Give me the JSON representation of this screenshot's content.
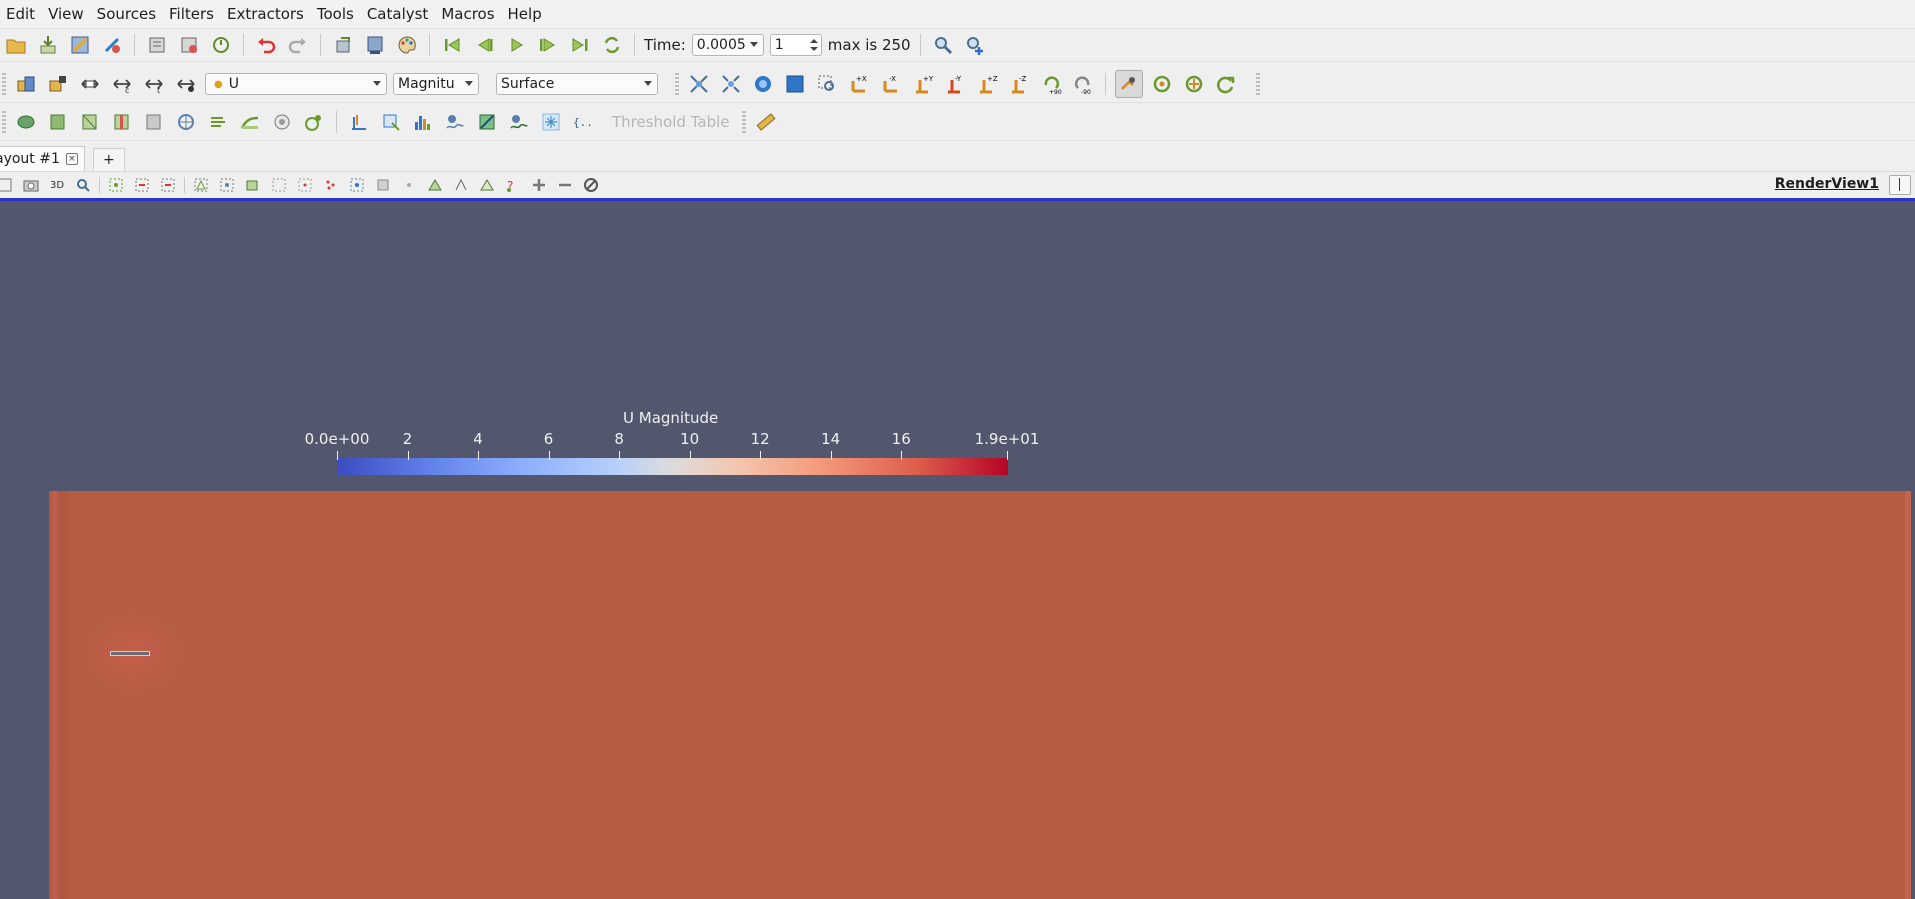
{
  "menubar": {
    "items": [
      "Edit",
      "View",
      "Sources",
      "Filters",
      "Extractors",
      "Tools",
      "Catalyst",
      "Macros",
      "Help"
    ]
  },
  "toolbar1": {
    "time_label": "Time:",
    "time_value": "0.0005",
    "timestep_value": "1",
    "max_label": "max is 250"
  },
  "toolbar2": {
    "array_selector": "U",
    "component_selector": "Magnitu",
    "representation_selector": "Surface"
  },
  "toolbar3": {
    "threshold_table_label": "Threshold Table"
  },
  "tabs": {
    "layout_tab": "ayout #1",
    "add_tab": "+"
  },
  "viewbar": {
    "render_view_name": "RenderView1",
    "three_d_label": "3D"
  },
  "colorbar": {
    "title": "U Magnitude",
    "tick_labels": [
      "0.0e+00",
      "2",
      "4",
      "6",
      "8",
      "10",
      "12",
      "14",
      "16",
      "1.9e+01"
    ],
    "tick_values": [
      0,
      2,
      4,
      6,
      8,
      10,
      12,
      14,
      16,
      19
    ],
    "range": [
      0,
      19
    ],
    "colormap": [
      "#3b4cc0",
      "#dddcdc",
      "#b40426"
    ]
  },
  "scene": {
    "background_color": "#52576e",
    "domain_color": "#b55c44"
  }
}
